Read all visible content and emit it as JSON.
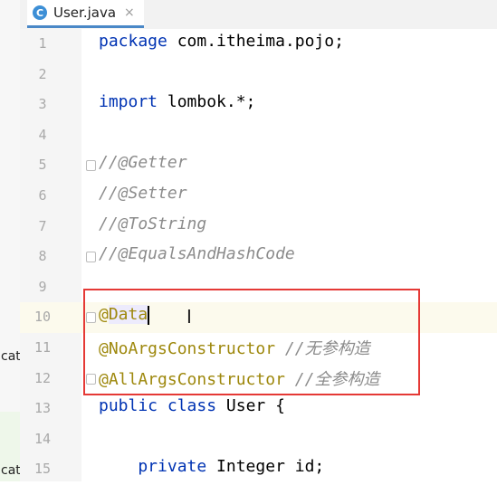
{
  "tab": {
    "icon": "C",
    "filename": "User.java",
    "close": "×"
  },
  "left_strip": {
    "labels": [
      "cat",
      "cat"
    ]
  },
  "lines": [
    {
      "num": "1",
      "parts": [
        {
          "t": "package ",
          "c": "kw"
        },
        {
          "t": "com.itheima.pojo;",
          "c": ""
        }
      ]
    },
    {
      "num": "2",
      "parts": []
    },
    {
      "num": "3",
      "parts": [
        {
          "t": "import ",
          "c": "kw"
        },
        {
          "t": "lombok.*;",
          "c": ""
        }
      ]
    },
    {
      "num": "4",
      "parts": []
    },
    {
      "num": "5",
      "fold": true,
      "parts": [
        {
          "t": "//@Getter",
          "c": "cmt"
        }
      ]
    },
    {
      "num": "6",
      "parts": [
        {
          "t": "//@Setter",
          "c": "cmt"
        }
      ]
    },
    {
      "num": "7",
      "parts": [
        {
          "t": "//@ToString",
          "c": "cmt"
        }
      ]
    },
    {
      "num": "8",
      "fold": true,
      "parts": [
        {
          "t": "//@EqualsAndHashCode",
          "c": "cmt"
        }
      ]
    },
    {
      "num": "9",
      "parts": []
    },
    {
      "num": "10",
      "fold": true,
      "current": true,
      "parts": [
        {
          "t": "@",
          "c": "ann"
        },
        {
          "t": "Data",
          "c": "ann sel"
        }
      ],
      "caret": true
    },
    {
      "num": "11",
      "parts": [
        {
          "t": "@NoArgsConstructor ",
          "c": "ann"
        },
        {
          "t": "//无参构造",
          "c": "cmt"
        }
      ]
    },
    {
      "num": "12",
      "fold": true,
      "parts": [
        {
          "t": "@AllArgsConstructor ",
          "c": "ann"
        },
        {
          "t": "//全参构造",
          "c": "cmt"
        }
      ]
    },
    {
      "num": "13",
      "parts": [
        {
          "t": "public ",
          "c": "kw"
        },
        {
          "t": "class ",
          "c": "kw"
        },
        {
          "t": "User {",
          "c": ""
        }
      ]
    },
    {
      "num": "14",
      "parts": []
    },
    {
      "num": "15",
      "parts": [
        {
          "t": "    private ",
          "c": "kw"
        },
        {
          "t": "Integer id;",
          "c": ""
        }
      ]
    }
  ],
  "colors": {
    "keyword": "#0033b3",
    "annotation": "#9e880d",
    "comment": "#8c8c8c",
    "highlight_box": "#e53935"
  }
}
